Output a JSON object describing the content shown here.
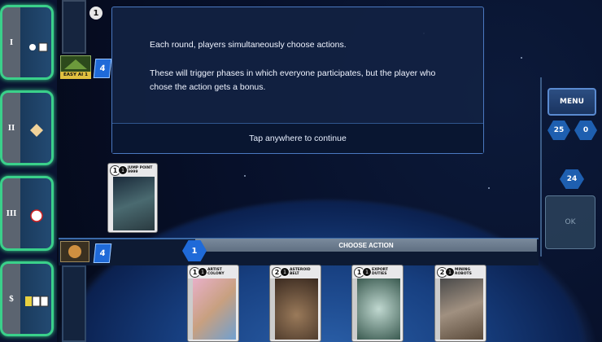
{
  "actions": [
    {
      "roman": "I",
      "icon": "explore-icons"
    },
    {
      "roman": "II",
      "icon": "diamond-icon"
    },
    {
      "roman": "III",
      "icon": "circle-icon"
    },
    {
      "roman": "$",
      "icon": "trade-icons"
    }
  ],
  "opponent": {
    "badge": "1",
    "label": "EASY AI 1",
    "deck_count": "4"
  },
  "dialog": {
    "line1": "Each round, players simultaneously choose actions.",
    "line2": "These will trigger phases in which everyone participates, but the player who chose the action gets a bonus.",
    "continue": "Tap anywhere to continue"
  },
  "tableau_card": {
    "cost": "1",
    "vp": "1",
    "title": "JUMP POINT 9999"
  },
  "right_panel": {
    "menu": "MENU",
    "vp_pool": "25",
    "my_vp": "0",
    "deck_total": "24",
    "ok": "OK"
  },
  "player": {
    "deck_count": "4",
    "round": "1"
  },
  "action_bar": {
    "label": "CHOOSE ACTION"
  },
  "hand": [
    {
      "cost": "1",
      "vp": "1",
      "title": "ARTIST COLONY",
      "art": "#c8a080"
    },
    {
      "cost": "2",
      "vp": "1",
      "title": "ASTEROID BELT",
      "art": "#6a5a4a"
    },
    {
      "cost": "1",
      "vp": "1",
      "title": "EXPORT DUTIES",
      "art": "#5a7a70"
    },
    {
      "cost": "2",
      "vp": "1",
      "title": "MINING ROBOTS",
      "art": "#7a6a5a"
    }
  ]
}
